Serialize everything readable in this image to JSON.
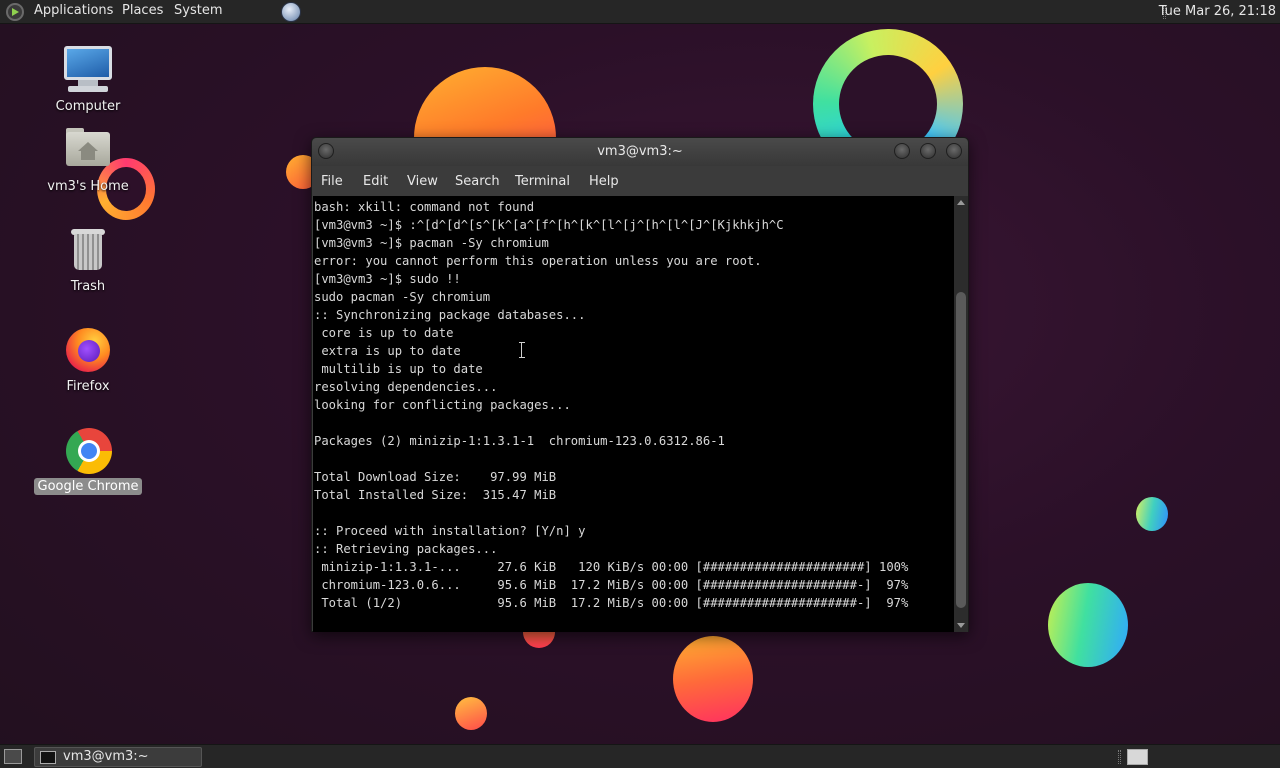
{
  "top_panel": {
    "menus": [
      "Applications",
      "Places",
      "System"
    ],
    "clock": "Tue Mar 26, 21:18"
  },
  "desktop_icons": [
    {
      "label": "Computer",
      "icon": "computer-icon"
    },
    {
      "label": "vm3's Home",
      "icon": "home-folder-icon"
    },
    {
      "label": "Trash",
      "icon": "trash-icon"
    },
    {
      "label": "Firefox",
      "icon": "firefox-icon"
    },
    {
      "label": "Google Chrome",
      "icon": "chrome-icon",
      "selected": true
    }
  ],
  "terminal": {
    "title": "vm3@vm3:~",
    "menu": [
      "File",
      "Edit",
      "View",
      "Search",
      "Terminal",
      "Help"
    ],
    "lines": [
      "bash: xkill: command not found",
      "[vm3@vm3 ~]$ :^[d^[d^[s^[k^[a^[f^[h^[k^[l^[j^[h^[l^[J^[Kjkhkjh^C",
      "[vm3@vm3 ~]$ pacman -Sy chromium",
      "error: you cannot perform this operation unless you are root.",
      "[vm3@vm3 ~]$ sudo !!",
      "sudo pacman -Sy chromium",
      ":: Synchronizing package databases...",
      " core is up to date",
      " extra is up to date",
      " multilib is up to date",
      "resolving dependencies...",
      "looking for conflicting packages...",
      "",
      "Packages (2) minizip-1:1.3.1-1  chromium-123.0.6312.86-1",
      "",
      "Total Download Size:    97.99 MiB",
      "Total Installed Size:  315.47 MiB",
      "",
      ":: Proceed with installation? [Y/n] y",
      ":: Retrieving packages...",
      " minizip-1:1.3.1-...     27.6 KiB   120 KiB/s 00:00 [######################] 100%",
      " chromium-123.0.6...     95.6 MiB  17.2 MiB/s 00:00 [#####################-]  97%",
      " Total (1/2)             95.6 MiB  17.2 MiB/s 00:00 [#####################-]  97%"
    ]
  },
  "taskbar": {
    "task_label": "vm3@vm3:~"
  }
}
